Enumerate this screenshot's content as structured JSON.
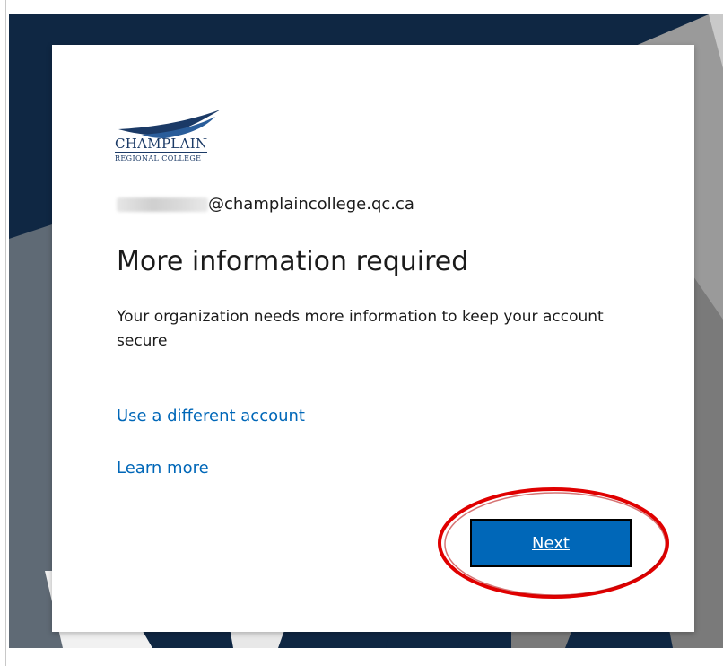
{
  "colors": {
    "background_dark": "#0f2743",
    "background_gray": "#7c7c7c",
    "card": "#ffffff",
    "accent": "#0067b8",
    "text": "#1b1b1b",
    "highlight": "#e00000"
  },
  "logo": {
    "name": "CHAMPLAIN",
    "subtitle": "REGIONAL COLLEGE",
    "icon": "champlain-swoosh-logo"
  },
  "identity": {
    "email_redacted_prefix": "",
    "email_domain_text": "@champlaincollege.qc.ca"
  },
  "page": {
    "title": "More information required",
    "description": "Your organization needs more information to keep your account secure"
  },
  "links": {
    "use_different_account": "Use a different account",
    "learn_more": "Learn more"
  },
  "actions": {
    "next_label": "Next"
  },
  "annotation": {
    "shape": "red-ellipse-highlight",
    "target": "Next"
  }
}
